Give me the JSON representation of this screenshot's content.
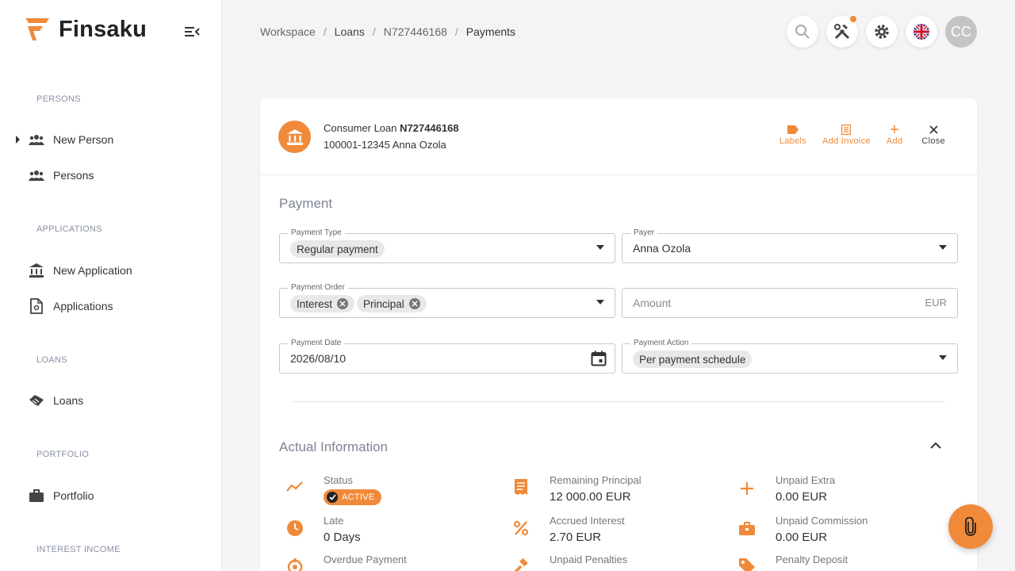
{
  "app": {
    "name": "Finsaku"
  },
  "sidebar": {
    "sections": [
      {
        "title": "PERSONS"
      },
      {
        "title": "APPLICATIONS"
      },
      {
        "title": "LOANS"
      },
      {
        "title": "PORTFOLIO"
      },
      {
        "title": "INTEREST INCOME"
      }
    ],
    "items": [
      {
        "label": "New Person",
        "icon": "people-icon"
      },
      {
        "label": "Persons",
        "icon": "people-icon"
      },
      {
        "label": "New Application",
        "icon": "bank-icon"
      },
      {
        "label": "Applications",
        "icon": "document-icon"
      },
      {
        "label": "Loans",
        "icon": "handshake-icon"
      },
      {
        "label": "Portfolio",
        "icon": "briefcase-icon"
      }
    ]
  },
  "breadcrumb": [
    "Workspace",
    "Loans",
    "N727446168",
    "Payments"
  ],
  "header": {
    "avatar_initials": "CC"
  },
  "loan": {
    "type_label": "Consumer Loan",
    "number": "N727446168",
    "subtitle": "100001-12345 Anna Ozola",
    "actions": {
      "labels": "Labels",
      "add_invoice": "Add Invoice",
      "add": "Add",
      "close": "Close"
    }
  },
  "payment": {
    "title": "Payment",
    "type": {
      "label": "Payment Type",
      "value": "Regular payment"
    },
    "payer": {
      "label": "Payer",
      "value": "Anna Ozola"
    },
    "order": {
      "label": "Payment Order",
      "chips": [
        "Interest",
        "Principal"
      ]
    },
    "amount": {
      "placeholder": "Amount",
      "currency": "EUR"
    },
    "date": {
      "label": "Payment Date",
      "value": "2026/08/10"
    },
    "action": {
      "label": "Payment Action",
      "value": "Per payment schedule"
    }
  },
  "actual": {
    "title": "Actual Information",
    "status": {
      "label": "Status",
      "badge": "ACTIVE"
    },
    "late": {
      "label": "Late",
      "value": "0 Days"
    },
    "overdue": {
      "label": "Overdue Payment"
    },
    "remaining_principal": {
      "label": "Remaining Principal",
      "value": "12 000.00 EUR"
    },
    "accrued_interest": {
      "label": "Accrued Interest",
      "value": "2.70 EUR"
    },
    "unpaid_penalties": {
      "label": "Unpaid Penalties"
    },
    "unpaid_extra": {
      "label": "Unpaid Extra",
      "value": "0.00 EUR"
    },
    "unpaid_commission": {
      "label": "Unpaid Commission",
      "value": "0.00 EUR"
    },
    "penalty_deposit": {
      "label": "Penalty Deposit"
    }
  },
  "colors": {
    "accent": "#f08a3a",
    "text": "#333333",
    "muted": "#7f8395"
  }
}
